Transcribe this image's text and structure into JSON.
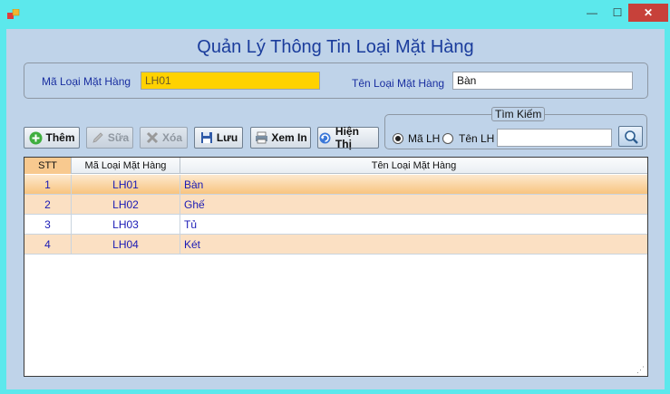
{
  "window": {
    "title": "",
    "minimize": "—",
    "maximize": "☐",
    "close": "✕"
  },
  "form": {
    "heading": "Quản Lý Thông Tin Loại Mặt Hàng",
    "ma_label": "Mã Loại Mặt Hàng",
    "ma_value": "LH01",
    "ten_label": "Tên Loại Mặt Hàng",
    "ten_value": "Bàn"
  },
  "toolbar": {
    "add": "Thêm",
    "edit": "Sữa",
    "delete": "Xóa",
    "save": "Lưu",
    "print": "Xem In",
    "show": "Hiện Thị"
  },
  "search": {
    "legend": "Tìm Kiếm",
    "option_ma": "Mã LH",
    "option_ten": "Tên LH",
    "selected": "Mã LH",
    "query": ""
  },
  "grid": {
    "columns": [
      "STT",
      "Mã Loại Mặt Hàng",
      "Tên Loại Mặt Hàng"
    ],
    "rows": [
      {
        "stt": "1",
        "ma": "LH01",
        "ten": "Bàn"
      },
      {
        "stt": "2",
        "ma": "LH02",
        "ten": "Ghế"
      },
      {
        "stt": "3",
        "ma": "LH03",
        "ten": "Tủ"
      },
      {
        "stt": "4",
        "ma": "LH04",
        "ten": "Két"
      }
    ]
  },
  "colors": {
    "accent": "#1a3c9c",
    "window_bg": "#5ce8ec",
    "client_bg": "#bfd3e9",
    "selected_row": "#f8c47f",
    "alt_row": "#fbe0c3",
    "input_highlight": "#ffd200"
  }
}
